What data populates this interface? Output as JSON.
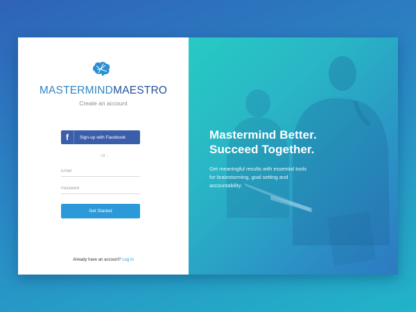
{
  "brand": {
    "part1": "MASTERMIND",
    "part2": "MAESTRO"
  },
  "signup": {
    "subtitle": "Create an account",
    "facebook_label": "Sign-up with Facebook",
    "facebook_icon": "f",
    "or_text": "- or -",
    "email_placeholder": "Email",
    "password_placeholder": "Password",
    "submit_label": "Get Started",
    "login_prompt": "Already have an account?",
    "login_link": "Log In"
  },
  "hero": {
    "line1": "Mastermind Better.",
    "line2": "Succeed Together.",
    "tagline": "Get meaningful results with essential tools for brainstorming, goal setting and accountability."
  },
  "colors": {
    "facebook": "#3b5eaa",
    "primary": "#2c9ad9",
    "brand_light": "#2f84c5",
    "brand_dark": "#1f4f9a"
  }
}
